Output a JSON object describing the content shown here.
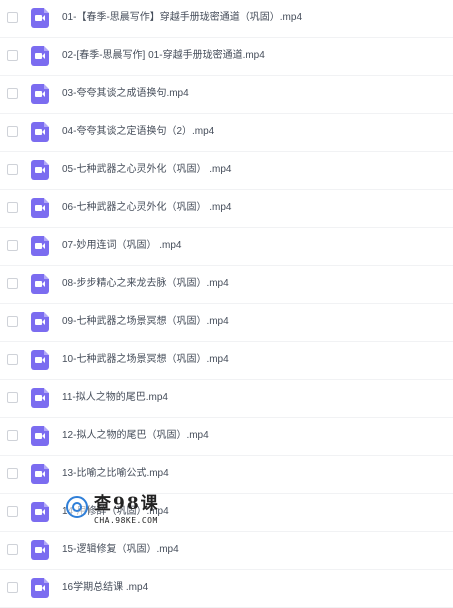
{
  "files": [
    {
      "name": "01-【春季-思晨写作】穿越手册珑密通道（巩固）.mp4",
      "icon": "video-file-icon"
    },
    {
      "name": "02-[春季-思晨写作] 01-穿越手册珑密通道.mp4",
      "icon": "video-file-icon"
    },
    {
      "name": "03-夸夸其谈之成语换句.mp4",
      "icon": "video-file-icon"
    },
    {
      "name": "04-夸夸其谈之定语换句（2）.mp4",
      "icon": "video-file-icon"
    },
    {
      "name": "05-七种武器之心灵外化（巩固） .mp4",
      "icon": "video-file-icon"
    },
    {
      "name": "06-七种武器之心灵外化（巩固） .mp4",
      "icon": "video-file-icon"
    },
    {
      "name": "07-妙用连词（巩固） .mp4",
      "icon": "video-file-icon"
    },
    {
      "name": "08-步步精心之来龙去脉（巩固）.mp4",
      "icon": "video-file-icon"
    },
    {
      "name": "09-七种武器之场景冥想（巩固）.mp4",
      "icon": "video-file-icon"
    },
    {
      "name": "10-七种武器之场景冥想（巩固）.mp4",
      "icon": "video-file-icon"
    },
    {
      "name": "11-拟人之物的尾巴.mp4",
      "icon": "video-file-icon"
    },
    {
      "name": "12-拟人之物的尾巴（巩固）.mp4",
      "icon": "video-file-icon"
    },
    {
      "name": "13-比喻之比喻公式.mp4",
      "icon": "video-file-icon"
    },
    {
      "name": "14-用修辞（巩固）.mp4",
      "icon": "video-file-icon"
    },
    {
      "name": "15-逻辑修复（巩固）.mp4",
      "icon": "video-file-icon"
    },
    {
      "name": "16学期总结课 .mp4",
      "icon": "video-file-icon"
    }
  ],
  "watermark": {
    "title": "查98课",
    "url": "CHA.98KE.COM"
  },
  "colors": {
    "icon_bg": "#7b6cf0",
    "text": "#454d5a",
    "divider": "#f1f2f4"
  }
}
